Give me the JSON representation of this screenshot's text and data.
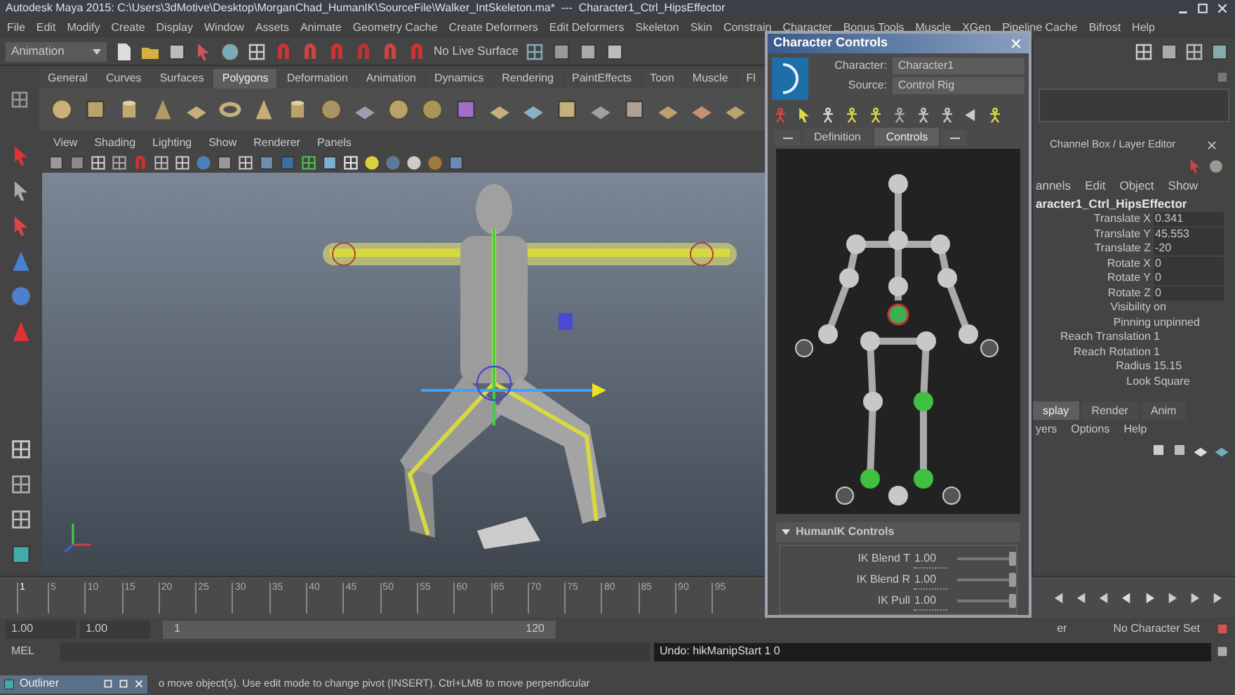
{
  "title_bar": {
    "title": "Autodesk Maya 2015: C:\\Users\\3dMotive\\Desktop\\MorganChad_HumanIK\\SourceFile\\Walker_IntSkeleton.ma*  ---  Character1_Ctrl_HipsEffector"
  },
  "menu_bar": [
    "File",
    "Edit",
    "Modify",
    "Create",
    "Display",
    "Window",
    "Assets",
    "Animate",
    "Geometry Cache",
    "Create Deformers",
    "Edit Deformers",
    "Skeleton",
    "Skin",
    "Constrain",
    "Character",
    "Bonus Tools",
    "Muscle",
    "XGen",
    "Pipeline Cache",
    "Bifrost",
    "Help"
  ],
  "status_line": {
    "menu_set": "Animation",
    "live_surface": "No Live Surface"
  },
  "shelf": {
    "tabs": [
      {
        "label": "General",
        "selected": false
      },
      {
        "label": "Curves",
        "selected": false
      },
      {
        "label": "Surfaces",
        "selected": false
      },
      {
        "label": "Polygons",
        "selected": true
      },
      {
        "label": "Deformation",
        "selected": false
      },
      {
        "label": "Animation",
        "selected": false
      },
      {
        "label": "Dynamics",
        "selected": false
      },
      {
        "label": "Rendering",
        "selected": false
      },
      {
        "label": "PaintEffects",
        "selected": false
      },
      {
        "label": "Toon",
        "selected": false
      },
      {
        "label": "Muscle",
        "selected": false
      },
      {
        "label": "Fl",
        "selected": false
      }
    ]
  },
  "viewport": {
    "menu": [
      "View",
      "Shading",
      "Lighting",
      "Show",
      "Renderer",
      "Panels"
    ]
  },
  "character_controls": {
    "title": "Character Controls",
    "character_label": "Character:",
    "character": "Character1",
    "source_label": "Source:",
    "source": "Control Rig",
    "tabs": [
      {
        "label": "Definition",
        "selected": false
      },
      {
        "label": "Controls",
        "selected": true
      }
    ],
    "humanik": {
      "title": "HumanIK Controls",
      "expanded": true,
      "sliders": [
        {
          "label": "IK Blend T",
          "value": "1.00",
          "level": 1
        },
        {
          "label": "IK Blend R",
          "value": "1.00",
          "level": 1
        },
        {
          "label": "IK Pull",
          "value": "1.00",
          "level": 1
        }
      ]
    }
  },
  "channel_box": {
    "title": "Channel Box / Layer Editor",
    "menu": [
      "annels",
      "Edit",
      "Object",
      "Show"
    ],
    "node": "aracter1_Ctrl_HipsEffector",
    "channels": [
      {
        "name": "Translate X",
        "value": "0.341",
        "kind": "field"
      },
      {
        "name": "Translate Y",
        "value": "45.553",
        "kind": "field"
      },
      {
        "name": "Translate Z",
        "value": "-20",
        "kind": "field"
      },
      {
        "name": "Rotate X",
        "value": "0",
        "kind": "field"
      },
      {
        "name": "Rotate Y",
        "value": "0",
        "kind": "field"
      },
      {
        "name": "Rotate Z",
        "value": "0",
        "kind": "field"
      },
      {
        "name": "Visibility",
        "value": "on",
        "kind": "plain"
      },
      {
        "name": "Pinning",
        "value": "unpinned",
        "kind": "plain"
      },
      {
        "name": "Reach Translation",
        "value": "1",
        "kind": "plain"
      },
      {
        "name": "Reach Rotation",
        "value": "1",
        "kind": "plain"
      },
      {
        "name": "Radius",
        "value": "15.15",
        "kind": "plain"
      },
      {
        "name": "Look",
        "value": "Square",
        "kind": "plain"
      }
    ]
  },
  "layer_editor": {
    "tabs": [
      {
        "label": "splay",
        "selected": true
      },
      {
        "label": "Render",
        "selected": false
      },
      {
        "label": "Anim",
        "selected": false
      }
    ],
    "menu": [
      "yers",
      "Options",
      "Help"
    ]
  },
  "timeline": {
    "ticks": [
      "1",
      "5",
      "10",
      "15",
      "20",
      "25",
      "30",
      "35",
      "40",
      "45",
      "50",
      "55",
      "60",
      "65",
      "70",
      "75",
      "80",
      "85",
      "90",
      "95"
    ]
  },
  "range": {
    "start": "1.00",
    "playback_start": "1.00",
    "slider_start": "1",
    "slider_end": "120",
    "cut_label": "er",
    "character_set": "No Character Set"
  },
  "command_line": {
    "label": "MEL",
    "result": "Undo: hikManipStart 1 0"
  },
  "help_line": "o move object(s). Use edit mode to change pivot (INSERT). Ctrl+LMB to move perpendicular",
  "outliner": {
    "title": "Outliner"
  }
}
